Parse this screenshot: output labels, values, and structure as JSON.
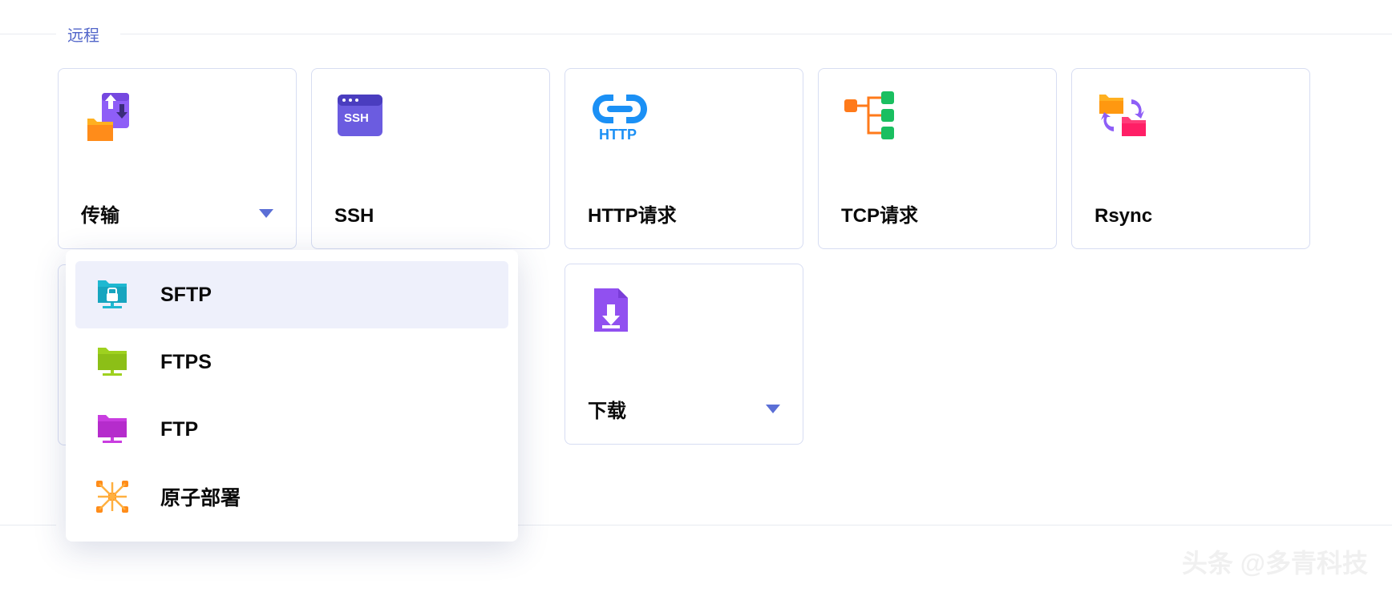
{
  "section": {
    "title": "远程"
  },
  "cards": [
    {
      "id": "transfer",
      "label": "传输",
      "has_dropdown": true
    },
    {
      "id": "ssh",
      "label": "SSH",
      "has_dropdown": false
    },
    {
      "id": "http",
      "label": "HTTP请求",
      "has_dropdown": false
    },
    {
      "id": "tcp",
      "label": "TCP请求",
      "has_dropdown": false
    },
    {
      "id": "rsync",
      "label": "Rsync",
      "has_dropdown": false
    }
  ],
  "row2": [
    {
      "id": "download",
      "label": "下载",
      "has_dropdown": true
    }
  ],
  "dropdown": {
    "items": [
      {
        "id": "sftp",
        "label": "SFTP",
        "active": true
      },
      {
        "id": "ftps",
        "label": "FTPS",
        "active": false
      },
      {
        "id": "ftp",
        "label": "FTP",
        "active": false
      },
      {
        "id": "atomic",
        "label": "原子部署",
        "active": false
      }
    ]
  },
  "watermark": "头条 @多青科技"
}
